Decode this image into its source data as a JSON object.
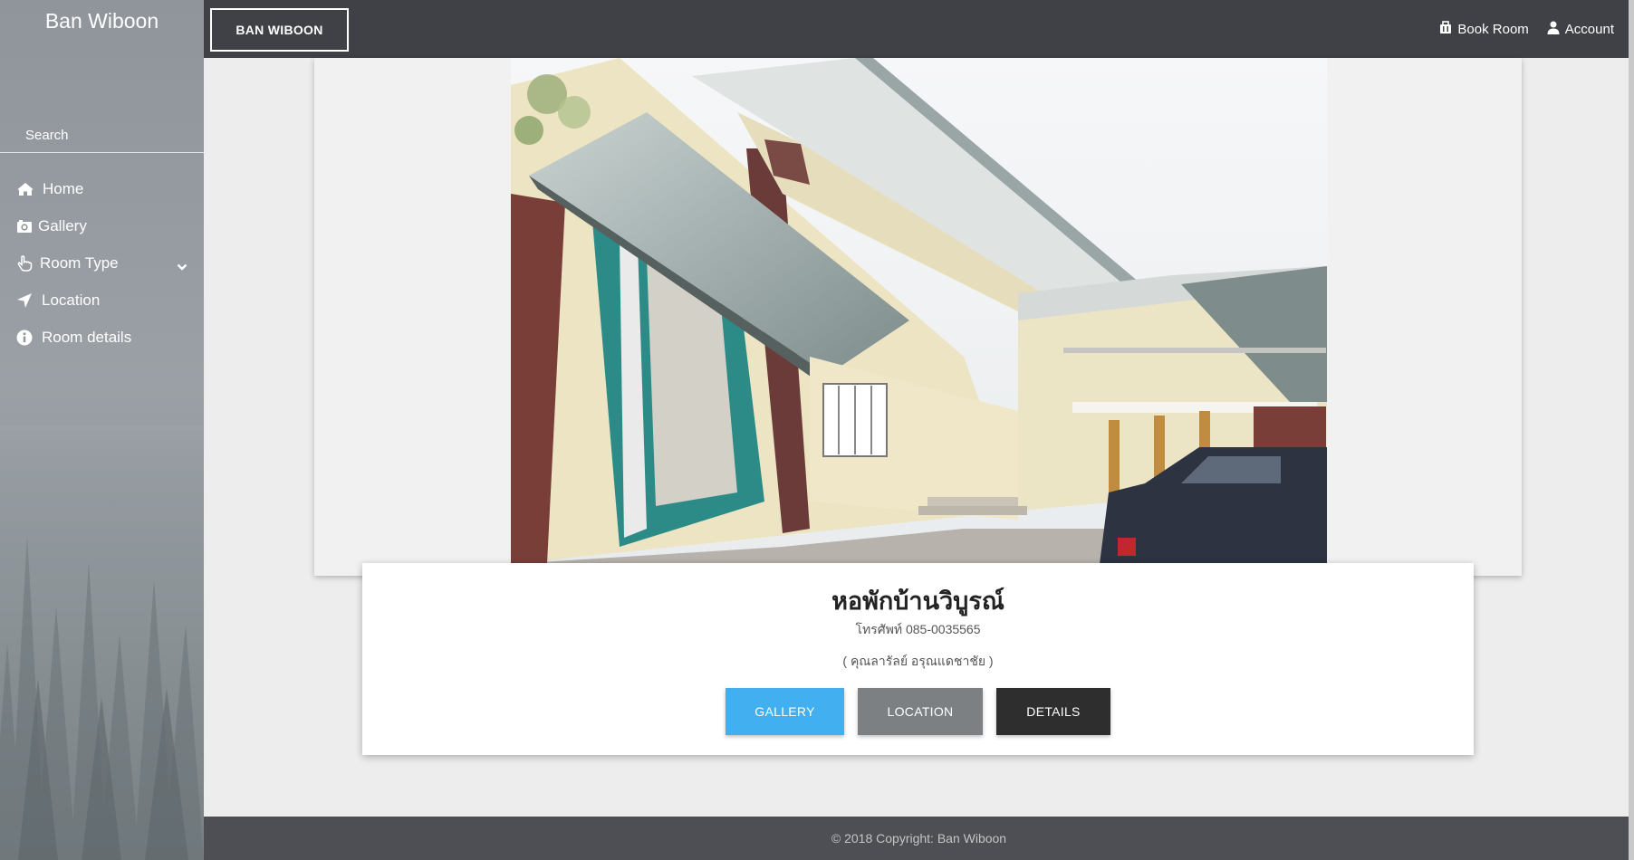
{
  "sidebar": {
    "brand": "Ban Wiboon",
    "search_placeholder": "Search",
    "items": [
      {
        "label": "Home",
        "icon": "home-icon"
      },
      {
        "label": "Gallery",
        "icon": "camera-icon"
      },
      {
        "label": "Room Type",
        "icon": "hand-pointer-icon",
        "has_dropdown": true
      },
      {
        "label": "Location",
        "icon": "location-arrow-icon"
      },
      {
        "label": "Room details",
        "icon": "info-circle-icon"
      }
    ]
  },
  "header": {
    "title_button": "BAN WIBOON",
    "book_room": "Book Room",
    "account": "Account"
  },
  "hero": {
    "image": "dormitory-building-photo"
  },
  "info": {
    "name": "หอพักบ้านวิบูรณ์",
    "phone": "โทรศัพท์ 085-0035565",
    "owner": "( คุณลารัลย์ อรุณแดชาชัย )",
    "buttons": {
      "gallery": "GALLERY",
      "location": "LOCATION",
      "details": "DETAILS"
    }
  },
  "footer": {
    "copyright": "© 2018 Copyright: Ban Wiboon"
  },
  "colors": {
    "topbar": "#3f4146",
    "gallery_button": "#42aff0",
    "location_button": "#7d8083",
    "details_button": "#2e2e2f",
    "footer": "#4d4f54"
  }
}
